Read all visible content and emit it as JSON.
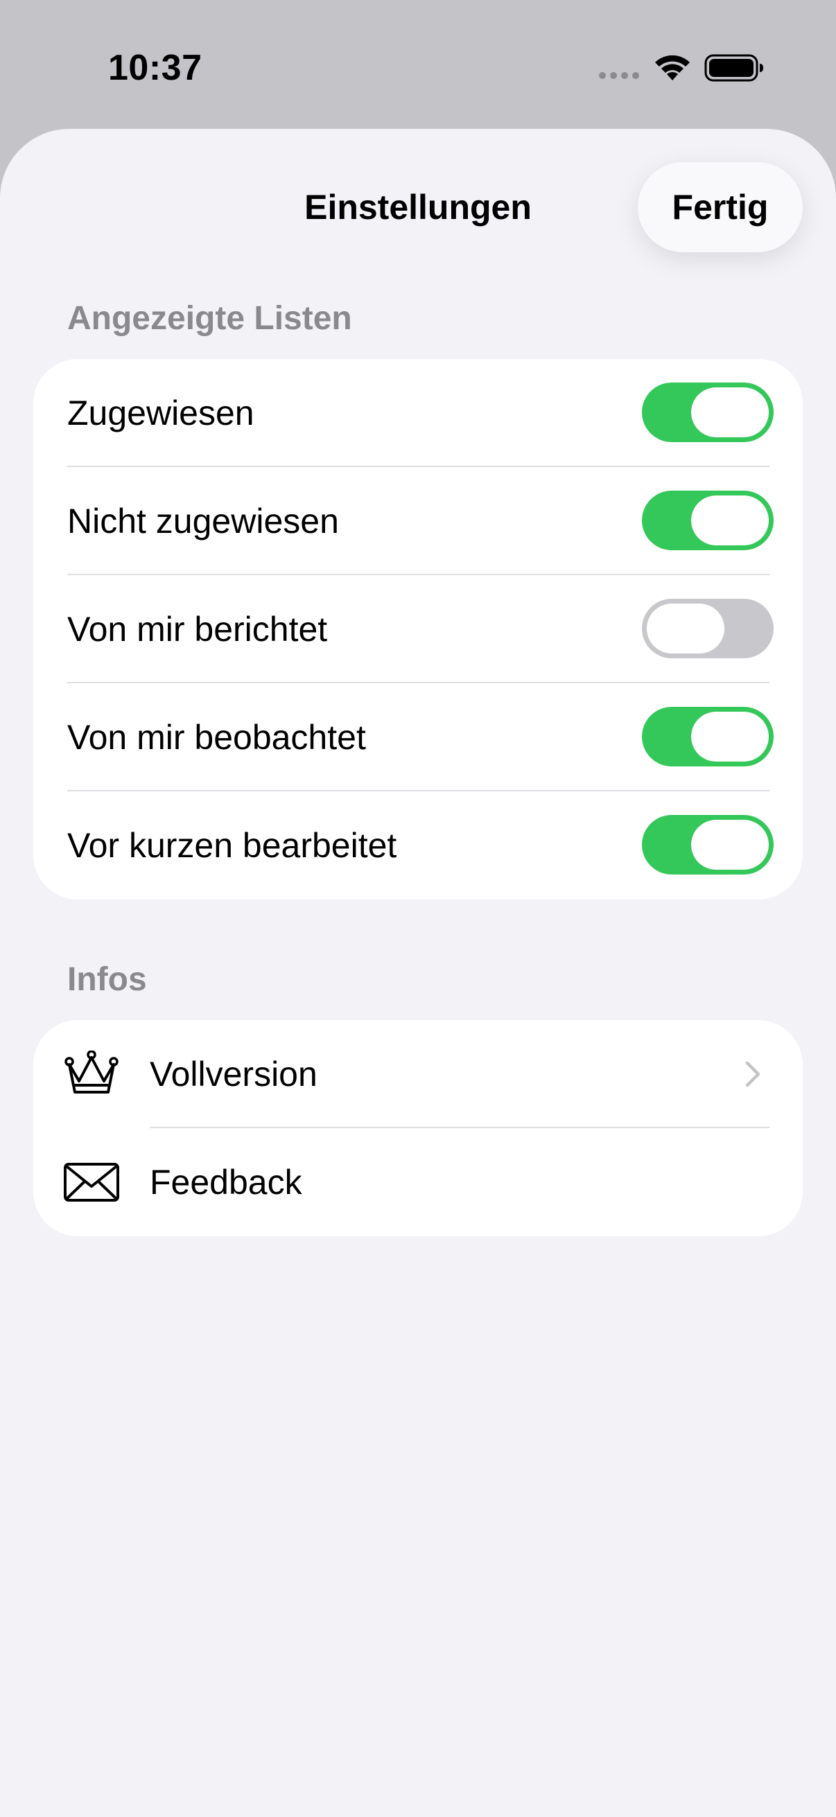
{
  "status_bar": {
    "time": "10:37"
  },
  "sheet": {
    "title": "Einstellungen",
    "done_label": "Fertig"
  },
  "lists_section": {
    "header": "Angezeigte Listen",
    "items": [
      {
        "label": "Zugewiesen",
        "enabled": true
      },
      {
        "label": "Nicht zugewiesen",
        "enabled": true
      },
      {
        "label": "Von mir berichtet",
        "enabled": false
      },
      {
        "label": "Von mir beobachtet",
        "enabled": true
      },
      {
        "label": "Vor kurzen bearbeitet",
        "enabled": true
      }
    ]
  },
  "info_section": {
    "header": "Infos",
    "items": [
      {
        "label": "Vollversion",
        "icon": "crown-icon"
      },
      {
        "label": "Feedback",
        "icon": "envelope-icon"
      }
    ]
  },
  "colors": {
    "toggle_on": "#34c759",
    "toggle_off": "#c8c8cc",
    "sheet_background": "#f2f2f7",
    "dimmed_background": "#c3c3c8"
  }
}
